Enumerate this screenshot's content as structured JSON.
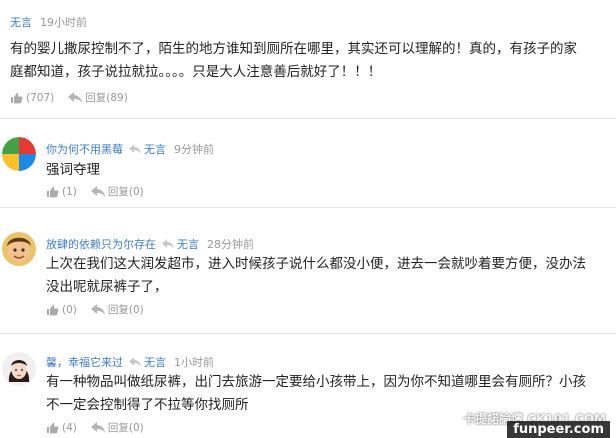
{
  "comments": [
    {
      "user": "无言",
      "reply_to": "",
      "time": "19小时前",
      "text_lines": [
        "有的婴儿撒尿控制不了，陌生的地方谁知到厕所在哪里，其实还可以理解的！真的，有孩子的家",
        "庭都知道，孩子说拉就拉。。。。只是大人注意善后就好了！！！"
      ],
      "likes": "(707)",
      "reply_label": "回复",
      "replies": "(89)"
    },
    {
      "user": "你为何不用黑莓",
      "reply_to": "无言",
      "time": "9分钟前",
      "text_lines": [
        "强词夺理"
      ],
      "likes": "(1)",
      "reply_label": "回复",
      "replies": "(0)"
    },
    {
      "user": "放肆的依赖只为尔存在",
      "reply_to": "无言",
      "time": "28分钟前",
      "text_lines": [
        "上次在我们这大润发超市，进入时候孩子说什么都没小便，进去一会就吵着要方便，没办法",
        "没出呢就尿裤子了，"
      ],
      "likes": "(0)",
      "reply_label": "回复",
      "replies": "(0)"
    },
    {
      "user": "馨，幸福它来过",
      "reply_to": "无言",
      "time": "1小时前",
      "text_lines": [
        "有一种物品叫做纸尿裤，出门去旅游一定要给小孩带上，因为你不知道哪里会有厕所？小孩",
        "不一定会控制得了不拉等你找厕所"
      ],
      "likes": "(4)",
      "reply_label": "回复",
      "replies": "(0)"
    }
  ],
  "watermark": {
    "top": "卡提諾論壇 CK101.COM",
    "bottom": "funpeer.com"
  },
  "colors": {
    "username": "#3f7cc7",
    "meta": "#999999",
    "separator": "#e4e4e4"
  },
  "icons": {
    "like": "thumbs-up-icon",
    "reply": "reply-arrow-icon",
    "reply_to": "reply-arrow-icon"
  }
}
